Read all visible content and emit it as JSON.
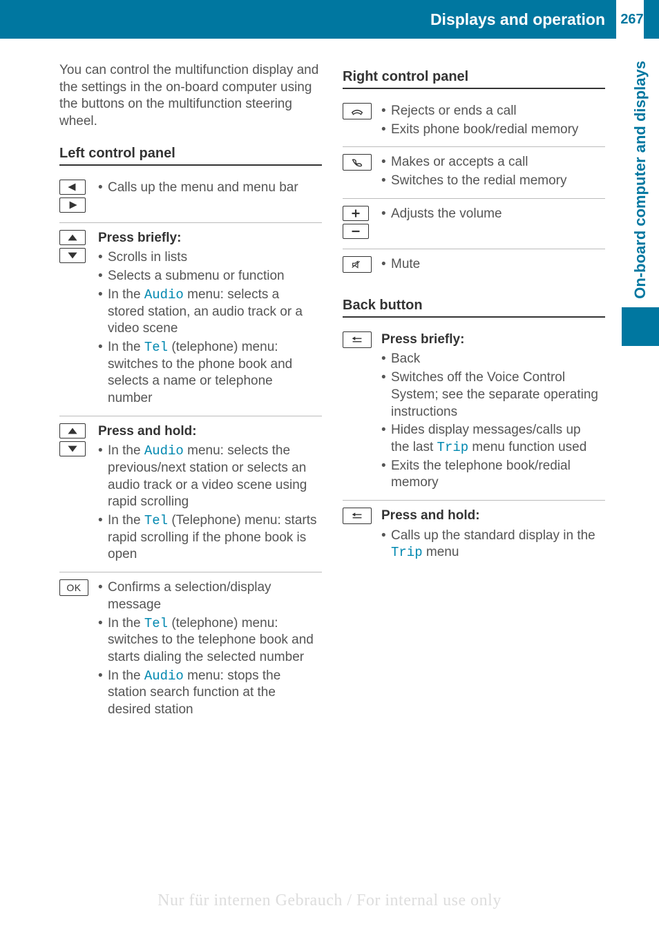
{
  "header": {
    "title": "Displays and operation",
    "page_number": "267"
  },
  "side_tab": "On-board computer and displays",
  "intro": "You can control the multifunction display and the settings in the on-board computer using the buttons on the multifunction steering wheel.",
  "left_panel": {
    "heading": "Left control panel",
    "rows": {
      "r1": {
        "b1": "Calls up the menu and menu bar"
      },
      "r2": {
        "title": "Press briefly:",
        "b1": "Scrolls in lists",
        "b2": "Selects a submenu or function",
        "b3a": "In the ",
        "b3m": "Audio",
        "b3b": " menu: selects a stored station, an audio track or a video scene",
        "b4a": "In the ",
        "b4m": "Tel",
        "b4b": " (telephone) menu: switches to the phone book and selects a name or telephone number"
      },
      "r3": {
        "title": "Press and hold:",
        "b1a": "In the ",
        "b1m": "Audio",
        "b1b": " menu: selects the previous/next station or selects an audio track or a video scene using rapid scrolling",
        "b2a": "In the ",
        "b2m": "Tel",
        "b2b": " (Telephone) menu: starts rapid scrolling if the phone book is open"
      },
      "r4": {
        "ok": "OK",
        "b1": "Confirms a selection/display message",
        "b2a": "In the ",
        "b2m": "Tel",
        "b2b": " (telephone) menu: switches to the telephone book and starts dialing the selected number",
        "b3a": "In the ",
        "b3m": "Audio",
        "b3b": " menu: stops the station search function at the desired station"
      }
    }
  },
  "right_panel": {
    "heading": "Right control panel",
    "rows": {
      "r1": {
        "b1": "Rejects or ends a call",
        "b2": "Exits phone book/redial memory"
      },
      "r2": {
        "b1": "Makes or accepts a call",
        "b2": "Switches to the redial memory"
      },
      "r3": {
        "b1": "Adjusts the volume"
      },
      "r4": {
        "b1": "Mute"
      }
    }
  },
  "back_button": {
    "heading": "Back button",
    "rows": {
      "r1": {
        "title": "Press briefly:",
        "b1": "Back",
        "b2": "Switches off the Voice Control System; see the separate operating instructions",
        "b3a": "Hides display messages/calls up the last ",
        "b3m": "Trip",
        "b3b": " menu function used",
        "b4": "Exits the telephone book/redial memory"
      },
      "r2": {
        "title": "Press and hold:",
        "b1a": "Calls up the standard display in the ",
        "b1m": "Trip",
        "b1b": " menu"
      }
    }
  },
  "watermark": "Nur für internen Gebrauch / For internal use only"
}
